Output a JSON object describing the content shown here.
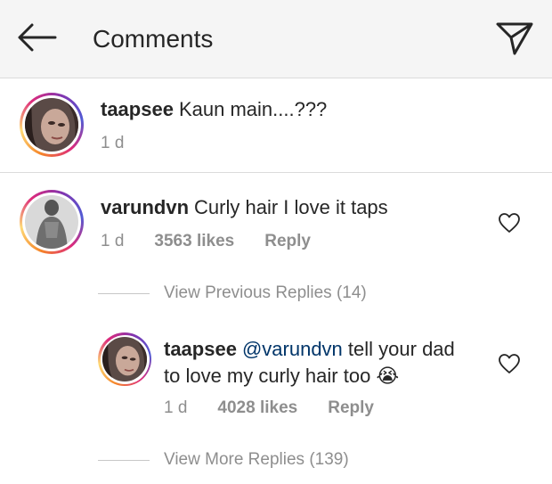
{
  "header": {
    "title": "Comments"
  },
  "caption": {
    "username": "taapsee",
    "text": "Kaun main....???",
    "time": "1 d"
  },
  "comments": [
    {
      "username": "varundvn",
      "text": "Curly hair I love it taps",
      "time": "1 d",
      "likes": "3563 likes",
      "reply_label": "Reply",
      "view_previous_replies": "View Previous Replies (14)",
      "replies": [
        {
          "username": "taapsee",
          "mention": "@varundvn",
          "text_line1": "tell your dad",
          "text_line2": "to love my curly hair too",
          "emoji": "😭",
          "time": "1 d",
          "likes": "4028 likes",
          "reply_label": "Reply"
        }
      ],
      "view_more_replies": "View More Replies (139)"
    }
  ],
  "colors": {
    "header_bg": "#f5f5f5",
    "text": "#262626",
    "muted": "#8e8e8e",
    "mention": "#003569"
  },
  "icons": [
    "back-arrow-icon",
    "send-icon",
    "heart-icon"
  ]
}
